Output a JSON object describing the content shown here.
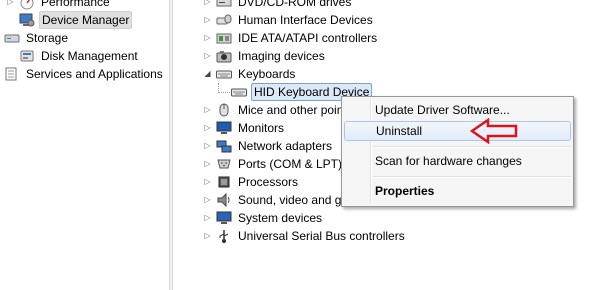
{
  "left_tree": {
    "items": [
      {
        "label": "Performance",
        "expander": "▷"
      },
      {
        "label": "Device Manager",
        "expander": ""
      },
      {
        "label": "Storage",
        "expander": "◢"
      },
      {
        "label": "Disk Management",
        "expander": ""
      },
      {
        "label": "Services and Applications",
        "expander": "▷"
      }
    ]
  },
  "device_tree": {
    "items": [
      {
        "label": "DVD/CD-ROM drives",
        "icon": "dvd-drive-icon"
      },
      {
        "label": "Human Interface Devices",
        "icon": "hid-icon"
      },
      {
        "label": "IDE ATA/ATAPI controllers",
        "icon": "ide-controller-icon"
      },
      {
        "label": "Imaging devices",
        "icon": "camera-icon"
      },
      {
        "label": "Keyboards",
        "icon": "keyboard-icon"
      },
      {
        "label": "HID Keyboard Device",
        "icon": "keyboard-icon"
      },
      {
        "label": "Mice and other poin",
        "icon": "mouse-icon"
      },
      {
        "label": "Monitors",
        "icon": "monitor-icon"
      },
      {
        "label": "Network adapters",
        "icon": "network-adapter-icon"
      },
      {
        "label": "Ports (COM & LPT)",
        "icon": "port-icon"
      },
      {
        "label": "Processors",
        "icon": "processor-icon"
      },
      {
        "label": "Sound, video and ga",
        "icon": "speaker-icon"
      },
      {
        "label": "System devices",
        "icon": "system-device-icon"
      },
      {
        "label": "Universal Serial Bus controllers",
        "icon": "usb-icon"
      }
    ],
    "expander_collapsed": "▷",
    "expander_expanded": "◢"
  },
  "context_menu": {
    "items": [
      {
        "label": "Update Driver Software..."
      },
      {
        "label": "Uninstall"
      },
      {
        "label": "Scan for hardware changes"
      },
      {
        "label": "Properties"
      }
    ]
  },
  "colors": {
    "annotation_arrow": "#d9141b",
    "selection_blue": "#dbe8f8",
    "menu_hover_border": "#a8c8ee"
  }
}
